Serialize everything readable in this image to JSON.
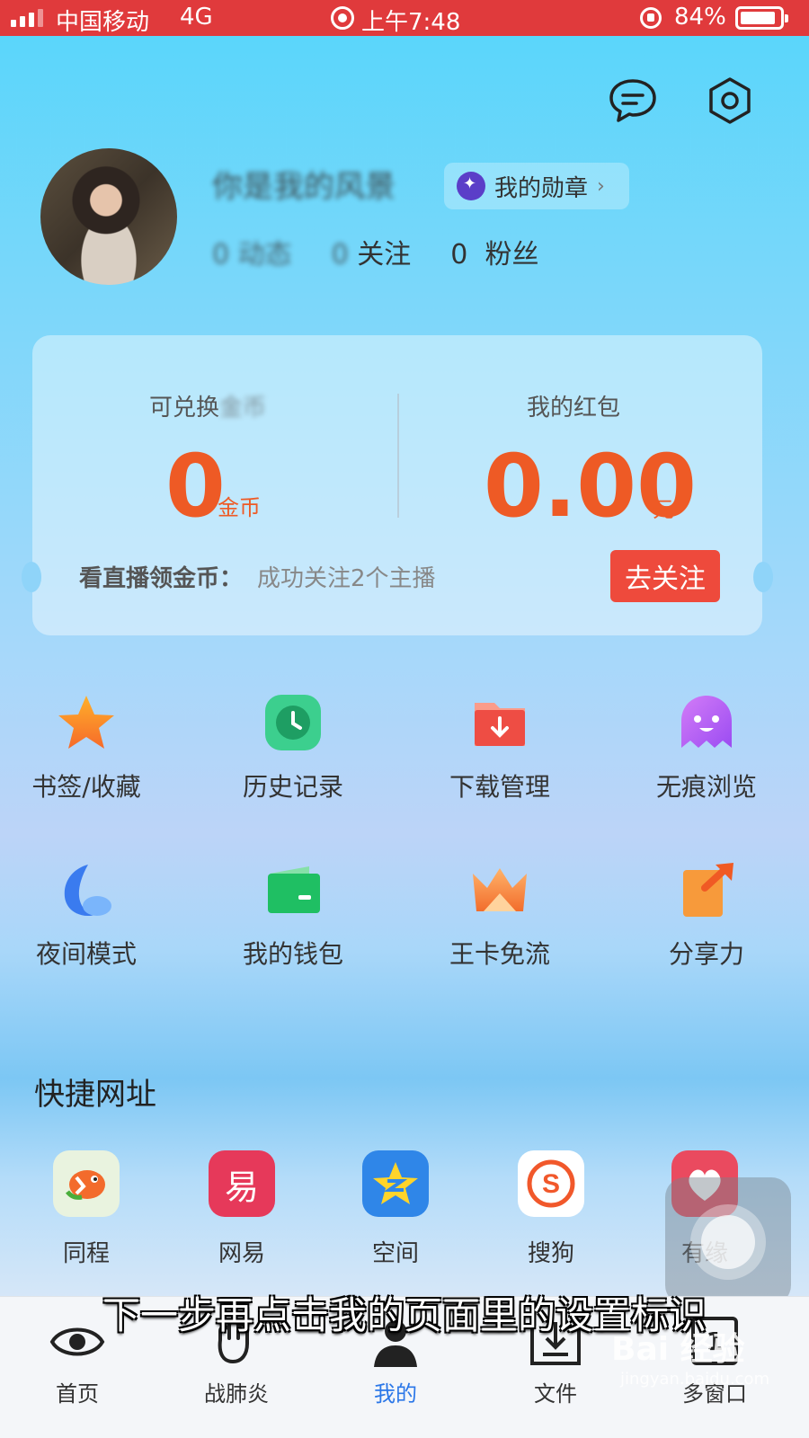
{
  "status_bar": {
    "carrier": "中国移动",
    "network": "4G",
    "time": "上午7:48",
    "battery": "84%"
  },
  "profile": {
    "username": "你是我的风景",
    "medal_label": "我的勋章",
    "stats": [
      {
        "count": "0",
        "label": "动态"
      },
      {
        "count": "0",
        "label": "关注"
      },
      {
        "count": "0",
        "label": "粉丝"
      }
    ]
  },
  "wallet_card": {
    "coin_label_visible": "可兑换",
    "coin_label_blurred": "金币",
    "coin_value": "0",
    "coin_unit": "金币",
    "red_packet_label": "我的红包",
    "red_packet_value": "0.00",
    "red_packet_unit": "元",
    "live_label": "看直播领金币：",
    "live_desc": "成功关注2个主播",
    "follow_button": "去关注"
  },
  "grid": [
    {
      "label": "书签/收藏",
      "icon": "star-icon"
    },
    {
      "label": "历史记录",
      "icon": "clock-icon"
    },
    {
      "label": "下载管理",
      "icon": "download-folder-icon"
    },
    {
      "label": "无痕浏览",
      "icon": "ghost-icon"
    },
    {
      "label": "夜间模式",
      "icon": "moon-icon"
    },
    {
      "label": "我的钱包",
      "icon": "wallet-icon"
    },
    {
      "label": "王卡免流",
      "icon": "crown-icon"
    },
    {
      "label": "分享力",
      "icon": "share-icon"
    }
  ],
  "shortcuts": {
    "title": "快捷网址",
    "items": [
      {
        "label": "同程",
        "icon": "tongcheng-icon"
      },
      {
        "label": "网易",
        "icon": "netease-icon",
        "glyph": "易"
      },
      {
        "label": "空间",
        "icon": "qzone-icon"
      },
      {
        "label": "搜狗",
        "icon": "sogou-icon"
      },
      {
        "label": "有缘",
        "icon": "youyuan-icon"
      }
    ]
  },
  "bottom_nav": [
    {
      "label": "首页",
      "icon": "eye-icon"
    },
    {
      "label": "战肺炎",
      "icon": "fist-icon"
    },
    {
      "label": "我的",
      "icon": "person-icon",
      "active": true
    },
    {
      "label": "文件",
      "icon": "file-download-icon"
    },
    {
      "label": "多窗口",
      "icon": "window-count-icon",
      "count": "1"
    }
  ],
  "caption": "下一步再点击我的页面里的设置标识",
  "watermark": {
    "main": "Bai 经验",
    "sub": "jingyan.baidu.com"
  },
  "colors": {
    "status_bar": "#e03a3c",
    "accent_orange": "#ee5a25",
    "follow_button": "#ee4a3c",
    "active_tab": "#2b77e8"
  }
}
